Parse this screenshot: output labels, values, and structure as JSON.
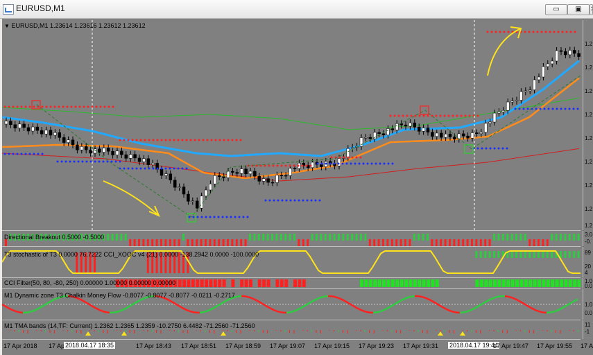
{
  "window": {
    "title": "EURUSD,M1",
    "buttons": {
      "minimize": "▭",
      "maximize": "▣",
      "close": "✕"
    }
  },
  "main_chart": {
    "header": "EURUSD,M1  1.23614 1.23616 1.23612 1.23612",
    "price_labels": [
      "1.2",
      "1.2",
      "1.2",
      "1.2",
      "1.2",
      "1.2",
      "1.2",
      "1.2",
      "1.2"
    ]
  },
  "indicators": {
    "directional": {
      "label": "Directional Breakout 0.5000 -0.5000",
      "scale": [
        "3.0",
        "-0."
      ]
    },
    "stochastic": {
      "label": "T3 stochastic of T3 0.0000 76.7222  CCI_XOOC v4 (21) 0.0000 -138.2942 0.0000 -100.0000",
      "scale": [
        "89",
        "20",
        "4"
      ]
    },
    "cci_filter": {
      "label": "CCI Filter(50, 80, -80, 250) 0.00000 1.00000 0.00000 0.00000",
      "scale": [
        "1.0",
        "0.0"
      ]
    },
    "dynamic_zone": {
      "label": "M1 Dynamic zone T3 Chalkin Money Flow  -0.8077 -0.8077 -0.8077 -0.0211 -0.2717",
      "scale": [
        "1.0",
        "0.0"
      ]
    },
    "tma_bands": {
      "label": "M1 TMA bands (14,TF: Current) 1.2362 1.2365 1.2359 -10.2750 6.4482 -71.2560 -71.2560",
      "scale": [
        "11",
        "-1"
      ]
    }
  },
  "time_axis": {
    "labels": [
      "17 Apr 2018",
      "17 Ap",
      "17 Apr 18:43",
      "17 Apr 18:51",
      "17 Apr 18:59",
      "17 Apr 19:07",
      "17 Apr 19:15",
      "17 Apr 19:23",
      "17 Apr 19:31",
      "17 Apr 19:47",
      "17 Apr 19:55",
      "17 A"
    ],
    "highlight_1": "2018.04.17 18:35",
    "highlight_2": "2018.04.17 19:44"
  }
}
